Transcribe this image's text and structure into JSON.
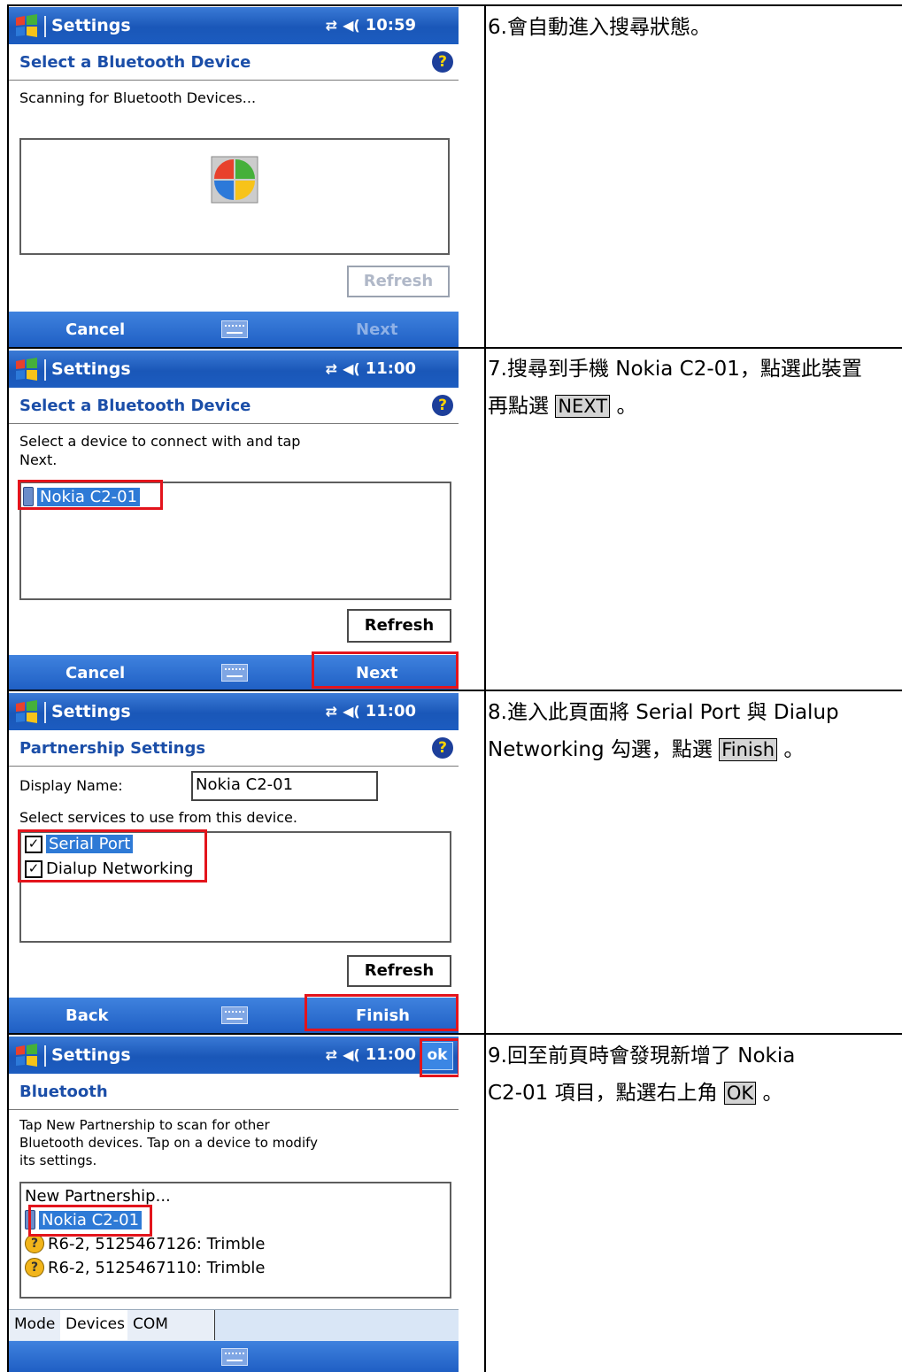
{
  "steps": [
    {
      "titlebar": {
        "app": "Settings",
        "time": "10:59"
      },
      "header": "Select a Bluetooth Device",
      "instruction": "Scanning for Bluetooth Devices...",
      "refresh_label": "Refresh",
      "left_soft": "Cancel",
      "right_soft": "Next",
      "description": "6.會自動進入搜尋狀態。"
    },
    {
      "titlebar": {
        "app": "Settings",
        "time": "11:00"
      },
      "header": "Select a Bluetooth Device",
      "instruction_line1": "Select a device to connect with and tap",
      "instruction_line2": "Next.",
      "devices": [
        "Nokia C2-01"
      ],
      "refresh_label": "Refresh",
      "left_soft": "Cancel",
      "right_soft": "Next",
      "description_a": "7.搜尋到手機 Nokia C2-01，點選此裝置",
      "description_b": "再點選",
      "description_hl": "NEXT",
      "description_c": "。"
    },
    {
      "titlebar": {
        "app": "Settings",
        "time": "11:00"
      },
      "header": "Partnership Settings",
      "display_name_label": "Display Name:",
      "display_name_value": "Nokia C2-01",
      "services_label": "Select services to use from this device.",
      "services": [
        "Serial Port",
        "Dialup Networking"
      ],
      "refresh_label": "Refresh",
      "left_soft": "Back",
      "right_soft": "Finish",
      "description_a": "8.進入此頁面將 Serial Port 與 Dialup",
      "description_b": "Networking 勾選，點選",
      "description_hl": "Finish",
      "description_c": "。"
    },
    {
      "titlebar": {
        "app": "Settings",
        "time": "11:00",
        "ok": "ok"
      },
      "header": "Bluetooth",
      "instruction_line1": "Tap New Partnership to scan for other",
      "instruction_line2": "Bluetooth devices. Tap on a device to modify",
      "instruction_line3": "its settings.",
      "list": [
        "New Partnership...",
        "Nokia C2-01",
        "R6-2, 5125467126: Trimble",
        "R6-2, 5125467110: Trimble"
      ],
      "tabs": [
        "Mode",
        "Devices",
        "COM Ports"
      ],
      "description_a": "9.回至前頁時會發現新增了 Nokia",
      "description_b": "C2-01 項目，點選右上角",
      "description_hl": "OK",
      "description_c": "。"
    }
  ],
  "colors": {
    "titlebar": "#1a57b8",
    "header_text": "#1b4ea8",
    "highlight": "#e3141c",
    "selection": "#2e7ad6"
  },
  "icons": [
    "windows-flag-icon",
    "connectivity-icon",
    "speaker-icon",
    "help-icon",
    "keyboard-icon",
    "phone-icon",
    "checkbox-icon",
    "unknown-device-icon"
  ]
}
